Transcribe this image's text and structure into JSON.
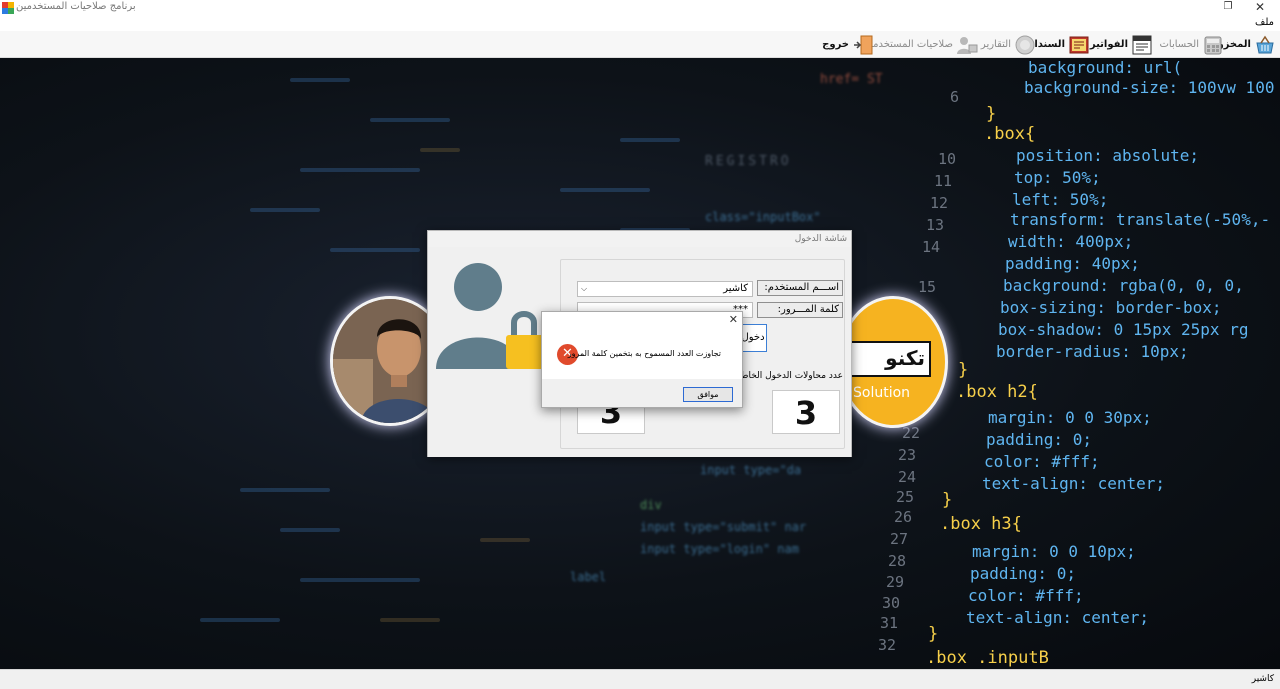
{
  "window": {
    "title": "برنامج صلاحيات المستخدمين",
    "icon": "app-window-icon"
  },
  "menu": {
    "file": "ملف"
  },
  "toolbar": {
    "items": [
      {
        "label": "المخزون",
        "icon": "store-basket-icon",
        "enabled": true
      },
      {
        "label": "الحسابات",
        "icon": "calculator-icon",
        "enabled": false
      },
      {
        "label": "الفواتير",
        "icon": "invoice-icon",
        "enabled": true
      },
      {
        "label": "السندات",
        "icon": "vouchers-icon",
        "enabled": true
      },
      {
        "label": "التقارير",
        "icon": "reports-icon",
        "enabled": false
      },
      {
        "label": "صلاحيات المستخدمين",
        "icon": "users-permissions-icon",
        "enabled": false
      },
      {
        "label": "خروج",
        "icon": "exit-door-icon",
        "enabled": true
      }
    ]
  },
  "background": {
    "code_right": [
      "background: url(",
      "background-size: 100vw 100",
      "}",
      ".box{",
      "position: absolute;",
      "top: 50%;",
      "left: 50%;",
      "transform: translate(-50%,-",
      "width: 400px;",
      "padding: 40px;",
      "background: rgba(0, 0, 0,",
      "box-sizing: border-box;",
      "box-shadow: 0 15px 25px rg",
      "border-radius: 10px;",
      "}",
      ".box h2{",
      "margin: 0 0 30px;",
      "padding: 0;",
      "color: #fff;",
      "text-align: center;",
      "}",
      ".box h3{",
      "margin: 0 0 10px;",
      "padding: 0;",
      "color: #fff;",
      "text-align: center;",
      "}",
      ".box .inputB"
    ],
    "line_numbers": [
      "6",
      "10",
      "11",
      "12",
      "13",
      "14",
      "15",
      "22",
      "23",
      "24",
      "25",
      "26",
      "27",
      "28",
      "29",
      "30",
      "31",
      "32"
    ],
    "code_blurred": [
      "href= ST",
      "REGISTRO",
      "class=\"inputBox\"",
      "input type=\"da",
      "input type=\"submit\" nar",
      "input type=\"login\" nam",
      "label",
      "div"
    ],
    "logo_text_ar": "تكنو",
    "logo_text_en": "Solution"
  },
  "login": {
    "title": "شاشة الدخول",
    "username_label": "اســـم المستخدم:",
    "username_value": "كاشير",
    "password_label": "كلمة المـــرور:",
    "password_value": "***",
    "login_button": "دخول",
    "attempts_label": "عدد محاولات الدخول الخاطئة",
    "attempts_left": "3",
    "attempts_right": "3"
  },
  "message": {
    "text": "تجاوزت العدد المسموح به بتخمين كلمة المرور",
    "ok": "موافق",
    "close": "✕",
    "icon": "error-icon"
  },
  "status": {
    "user": "كاشير"
  },
  "colors": {
    "error": "#e04a2c",
    "accent": "#3c7fd6",
    "logo_bg": "#f6b320",
    "code_property": "#5fb5f0",
    "code_value": "#ff7b5c",
    "code_number": "#7ee787",
    "code_brace": "#f7d04a"
  }
}
